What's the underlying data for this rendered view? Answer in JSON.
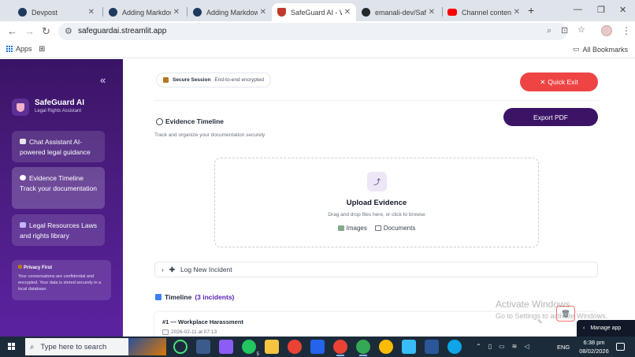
{
  "browser": {
    "tabs": [
      {
        "title": "Devpost",
        "color": "#1f3a5f"
      },
      {
        "title": "Adding Markdown",
        "color": "#1f3a5f"
      },
      {
        "title": "Adding Markdown",
        "color": "#1f3a5f"
      },
      {
        "title": "SafeGuard AI - Wo",
        "color": "#c0392b",
        "active": true
      },
      {
        "title": "emanali-dev/Safe",
        "color": "#24292e"
      },
      {
        "title": "Channel content -",
        "color": "#ff0000"
      }
    ],
    "url": "safeguardai.streamlit.app",
    "bookmarks": {
      "apps_label": "Apps",
      "all_label": "All Bookmarks"
    }
  },
  "sidebar": {
    "brand_name": "SafeGuard AI",
    "brand_subtitle": "Legal Rights Assistant",
    "nav": [
      {
        "label": "Chat Assistant AI-powered legal guidance",
        "icon": "chat-icon",
        "icon_color": "#e5e7eb"
      },
      {
        "label": "Evidence Timeline Track your documentation",
        "icon": "clock-icon",
        "icon_color": "#ffffff"
      },
      {
        "label": "Legal Resources Laws and rights library",
        "icon": "book-icon",
        "icon_color": "#c4b5fd"
      }
    ],
    "privacy_title": "Privacy First",
    "privacy_text": "Your conversations are confidential and encrypted. Your data is stored securely in a local database."
  },
  "main": {
    "session_label": "Secure Session",
    "session_detail": "End-to-end encrypted",
    "quick_exit": "Quick Exit",
    "export_pdf": "Export PDF",
    "evidence_title": "Evidence Timeline",
    "evidence_sub": "Track and organize your documentation securely",
    "upload_title": "Upload Evidence",
    "upload_sub": "Drag and drop files here, or click to browse",
    "upload_images": "Images",
    "upload_documents": "Documents",
    "log_incident": "Log New Incident",
    "timeline_title": "Timeline",
    "timeline_count": "(3 incidents)",
    "incident_title": "#1 — Workplace Harassment",
    "incident_date": "2026-02-11 at 07:13"
  },
  "overlay": {
    "watermark_title": "Activate Windows",
    "watermark_sub": "Go to Settings to activate Windows.",
    "manage_app": "Manage app"
  },
  "taskbar": {
    "search_placeholder": "Type here to search",
    "language": "ENG",
    "time": "6:38 pm",
    "date": "08/02/2026",
    "whatsapp_badge": "5"
  },
  "colors": {
    "accent_purple": "#3b1466",
    "danger_red": "#ef4444",
    "sidebar_gradient_top": "#3a1466",
    "sidebar_gradient_bottom": "#5b22a0"
  }
}
